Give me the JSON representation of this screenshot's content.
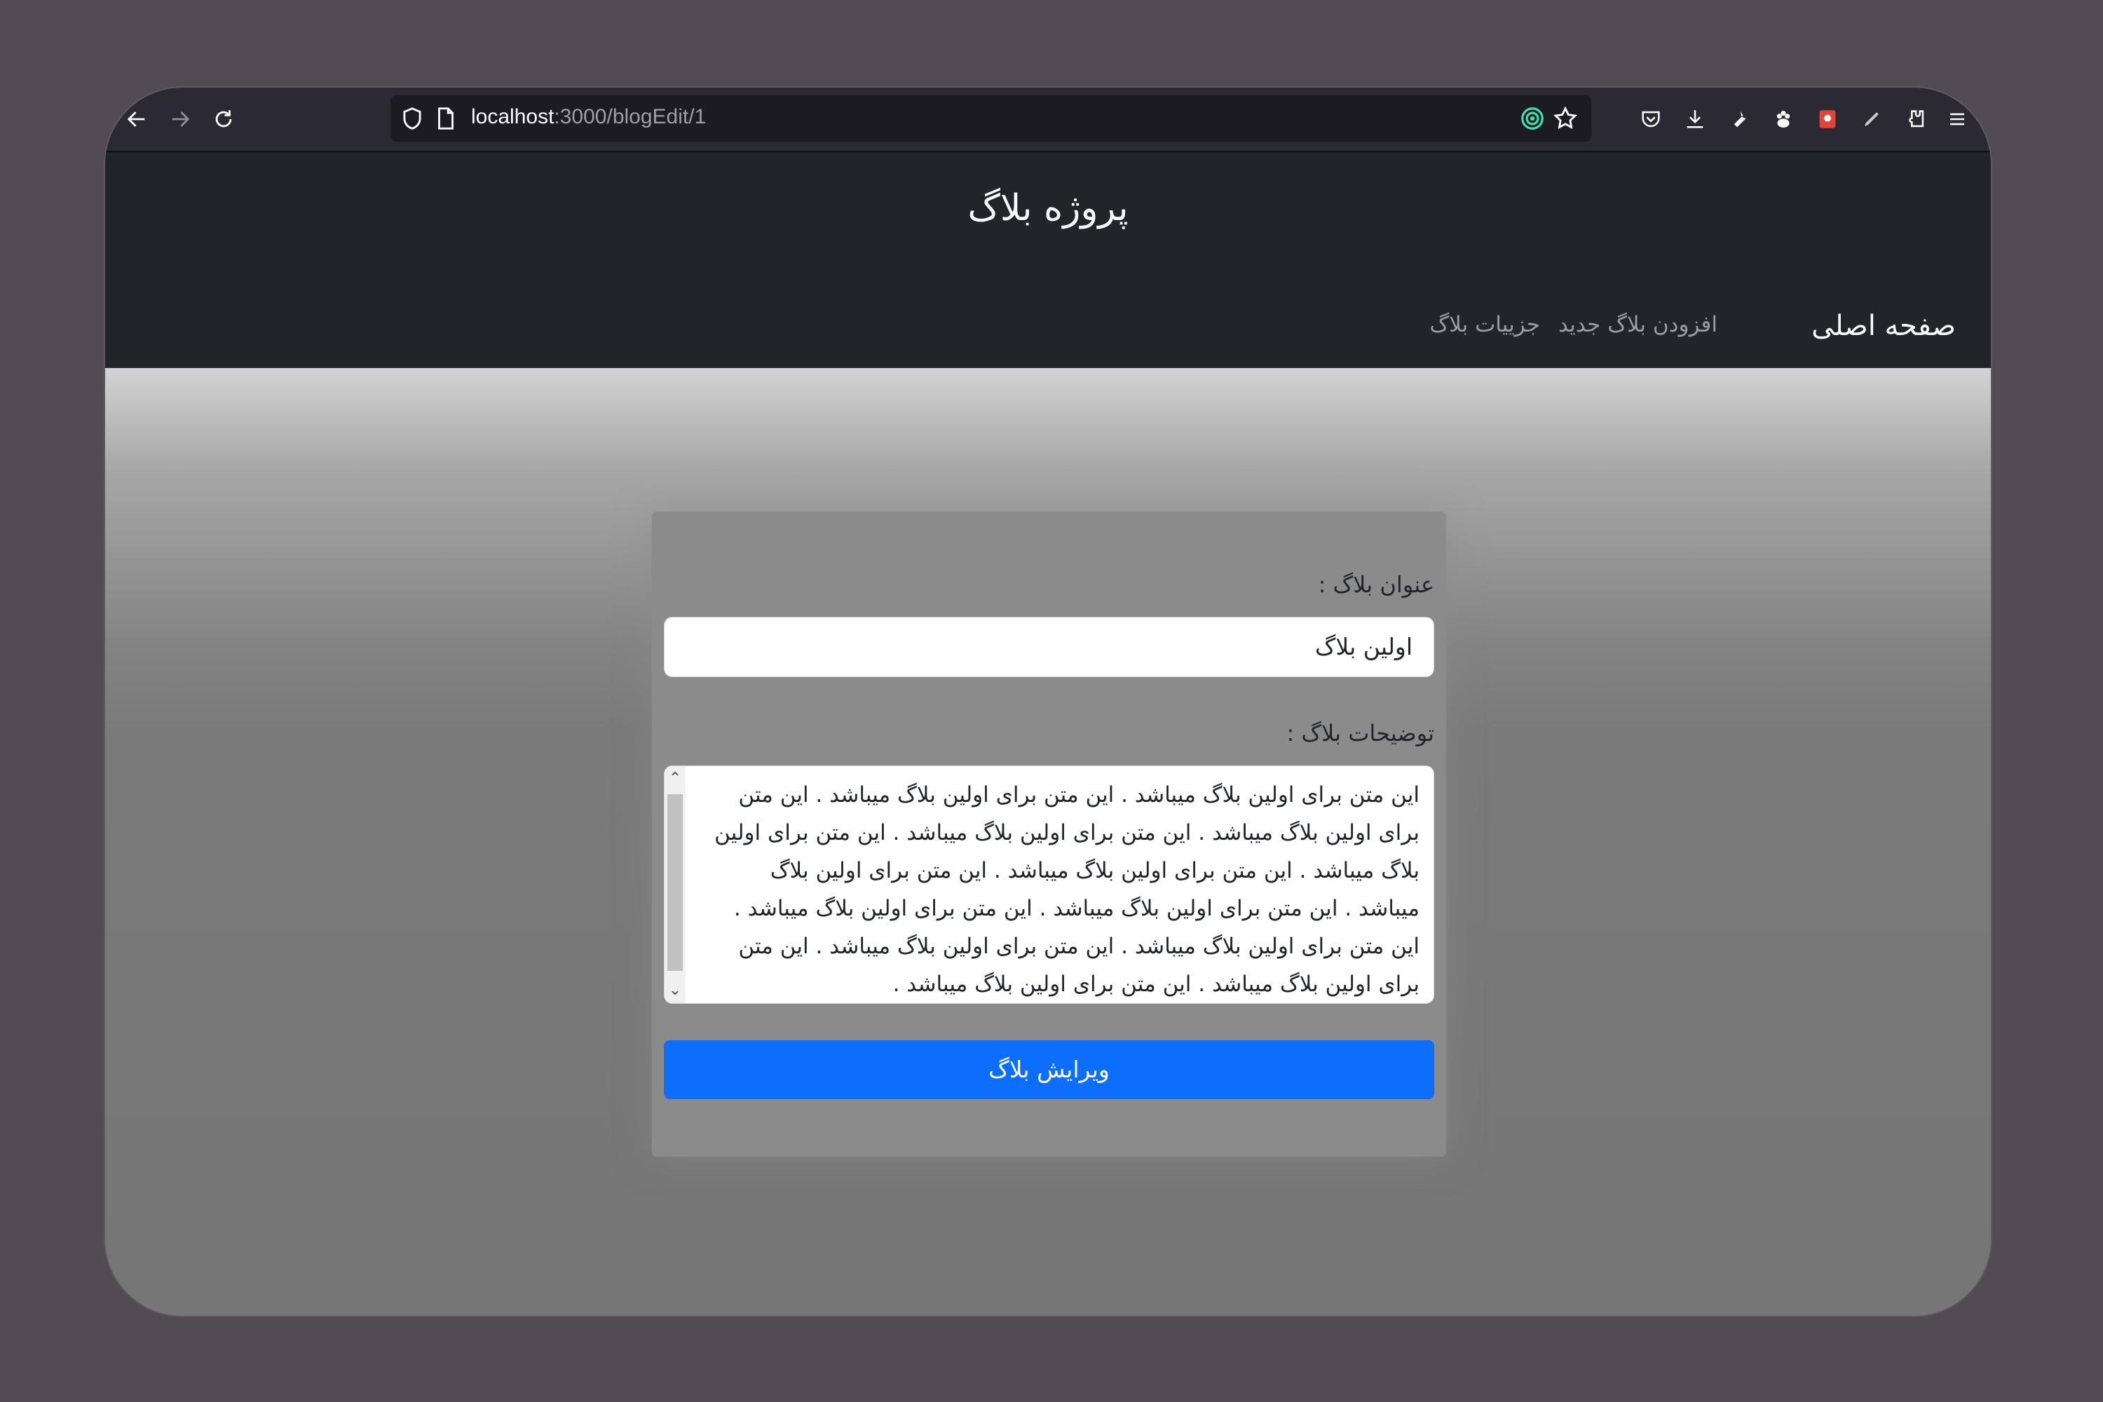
{
  "browser": {
    "url_host": "localhost",
    "url_rest": ":3000/blogEdit/1"
  },
  "site": {
    "title": "پروژه بلاگ",
    "brand": "صفحه اصلی",
    "nav": [
      {
        "label": "افزودن بلاگ جدید"
      },
      {
        "label": "جزییات بلاگ"
      }
    ]
  },
  "form": {
    "title_label": "عنوان بلاگ :",
    "title_value": "اولین بلاگ",
    "description_label": "توضیحات بلاگ :",
    "description_value": "این متن برای اولین بلاگ میباشد . این متن برای اولین بلاگ میباشد . این متن برای اولین بلاگ میباشد . این متن برای اولین بلاگ میباشد . این متن برای اولین بلاگ میباشد . این متن برای اولین بلاگ میباشد . این متن برای اولین بلاگ میباشد . این متن برای اولین بلاگ میباشد . این متن برای اولین بلاگ میباشد . این متن برای اولین بلاگ میباشد . این متن برای اولین بلاگ میباشد . این متن برای اولین بلاگ میباشد . این متن برای اولین بلاگ میباشد .",
    "submit_label": "ویرایش بلاگ"
  },
  "colors": {
    "desktop_bg": "#524b54",
    "toolbar_bg": "#2b2a33",
    "header_bg": "#212529",
    "button_bg": "#0d6efd"
  }
}
